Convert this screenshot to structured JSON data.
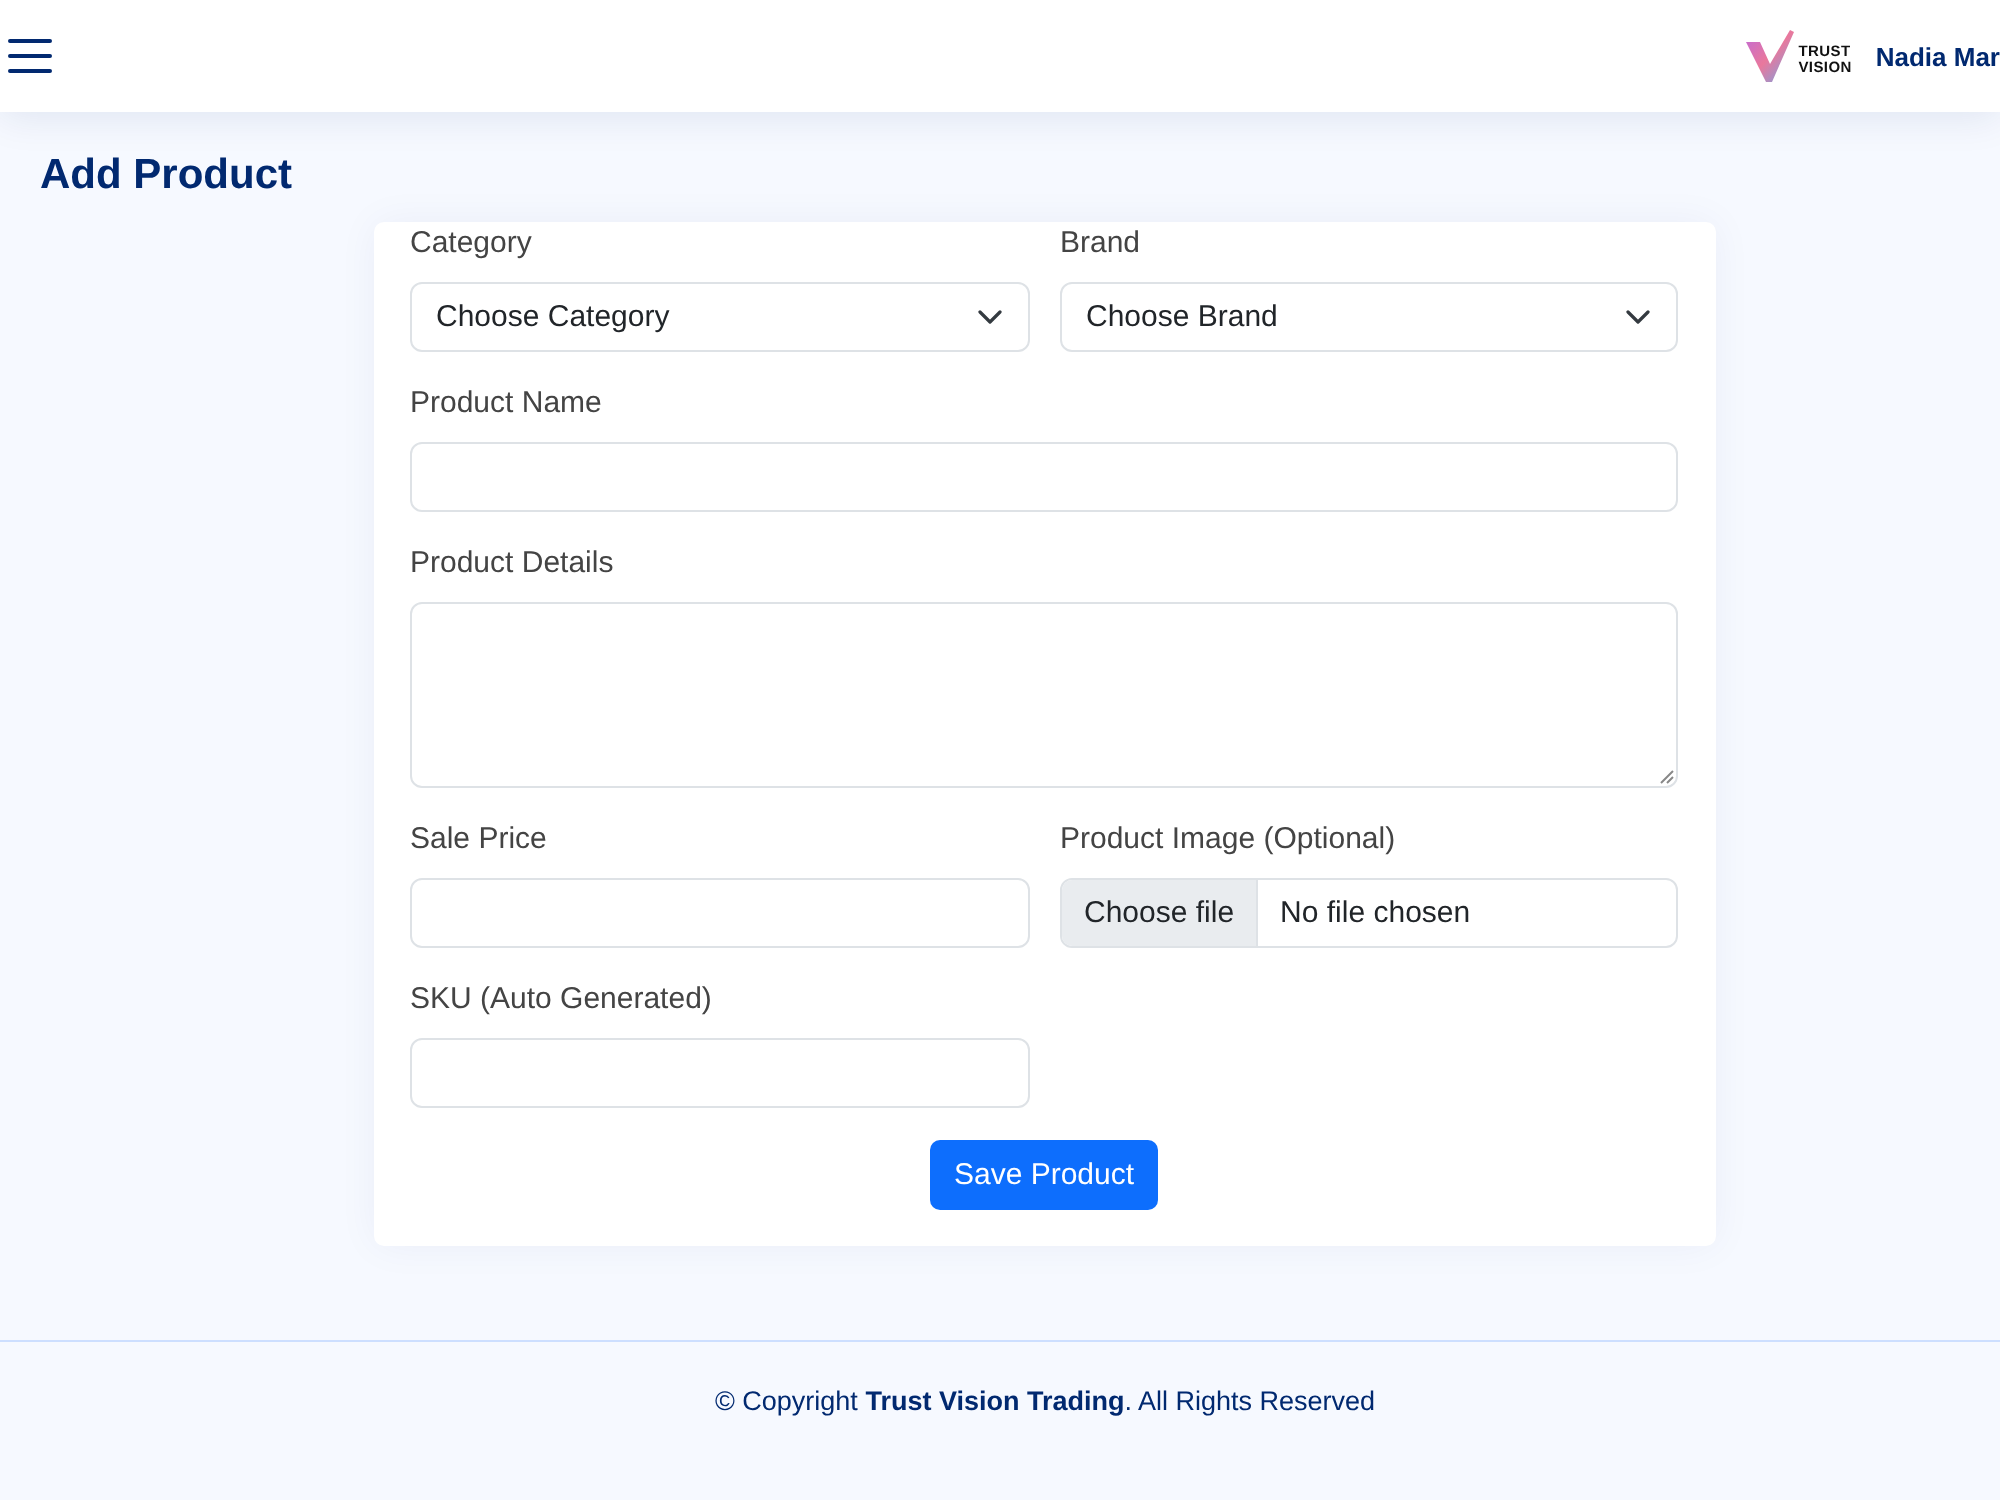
{
  "header": {
    "logo": {
      "line_1": "TRUST",
      "line_2": "VISION"
    },
    "user_name": "Nadia Mar"
  },
  "page_title": "Add Product",
  "form": {
    "fields": [
      {
        "kind": "select",
        "label": "Category",
        "value": "Choose Category",
        "full_width": false
      },
      {
        "kind": "select",
        "label": "Brand",
        "value": "Choose Brand",
        "full_width": false
      },
      {
        "kind": "text",
        "label": "Product Name",
        "full_width": true
      },
      {
        "kind": "textarea",
        "label": "Product Details",
        "full_width": true
      },
      {
        "kind": "text",
        "label": "Sale Price",
        "full_width": false
      },
      {
        "kind": "file",
        "label": "Product Image (Optional)",
        "button": "Choose file",
        "value": "No file chosen",
        "full_width": false
      },
      {
        "kind": "text",
        "label": "SKU (Auto Generated)",
        "full_width": false
      }
    ],
    "submit": "Save Product"
  },
  "footer": {
    "text": "© Copyright **Trust Vision Trading**. All Rights Reserved"
  }
}
